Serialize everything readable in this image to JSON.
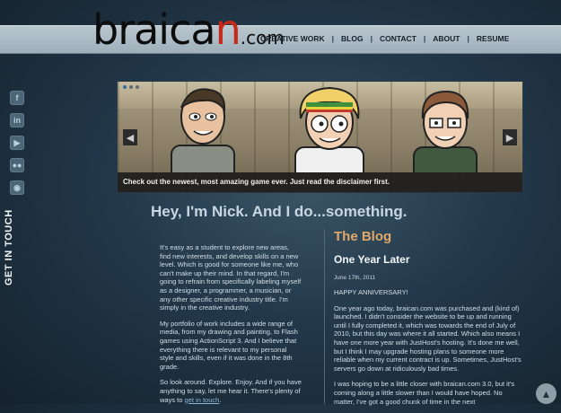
{
  "logo": {
    "brand_dark": "braica",
    "brand_red": "n",
    "tld": ".com"
  },
  "nav": {
    "items": [
      "CREATIVE WORK",
      "BLOG",
      "CONTACT",
      "ABOUT",
      "RESUME"
    ],
    "separator": "|"
  },
  "social": [
    {
      "icon": "facebook-icon",
      "glyph": "f"
    },
    {
      "icon": "linkedin-icon",
      "glyph": "in"
    },
    {
      "icon": "youtube-icon",
      "glyph": "▶"
    },
    {
      "icon": "flickr-icon",
      "glyph": "●●"
    },
    {
      "icon": "rss-icon",
      "glyph": "◉"
    }
  ],
  "sidebar_label": "GET IN TOUCH",
  "slider": {
    "caption": "Check out the newest, most amazing game ever. Just read the disclaimer first."
  },
  "headline": "Hey, I'm Nick. And I do...something.",
  "intro": {
    "p1": "It's easy as a student to explore new areas, find new interests, and develop skills on a new level. Which is good for someone like me, who can't make up their mind. In that regard, I'm going to refrain from specifically labeling myself as a designer, a programmer, a musician, or any other specific creative industry title. I'm simply in the creative industry.",
    "p2": "My portfolio of work includes a wide range of media, from my drawing and painting, to Flash games using ActionScript 3. And I believe that everything there is relevant to my personal style and skills, even if it was done in the 8th grade.",
    "p3_start": "So look around. Explore. Enjoy. And if you have anything to say, let me hear it. There's plenty of ways to",
    "p3_link": "get in touch",
    "p3_end": "."
  },
  "blog": {
    "title": "The Blog",
    "post_title": "One Year Later",
    "date": "June 17th, 2011",
    "p1": "HAPPY ANNIVERSARY!",
    "p2": "One year ago today, braican.com was purchased and (kind of) launched. I didn't consider the website to be up and running until I fully completed it, which was towards the end of July of 2010, but this day was where it all started. Which also means I have one more year with JustHost's hosting. It's done me well, but I think I may upgrade hosting plans to someone more reliable when my current contract is up. Sometimes, JustHost's servers go down at ridiculously bad times.",
    "p3": "I was hoping to be a little closer with braican.com 3.0, but it's coming along a little slower than I would have hoped. No matter, I've got a good chunk of time in the next"
  },
  "colors": {
    "accent_red": "#c4291a",
    "blog_title": "#e0a86a",
    "link": "#8fb7d4"
  }
}
